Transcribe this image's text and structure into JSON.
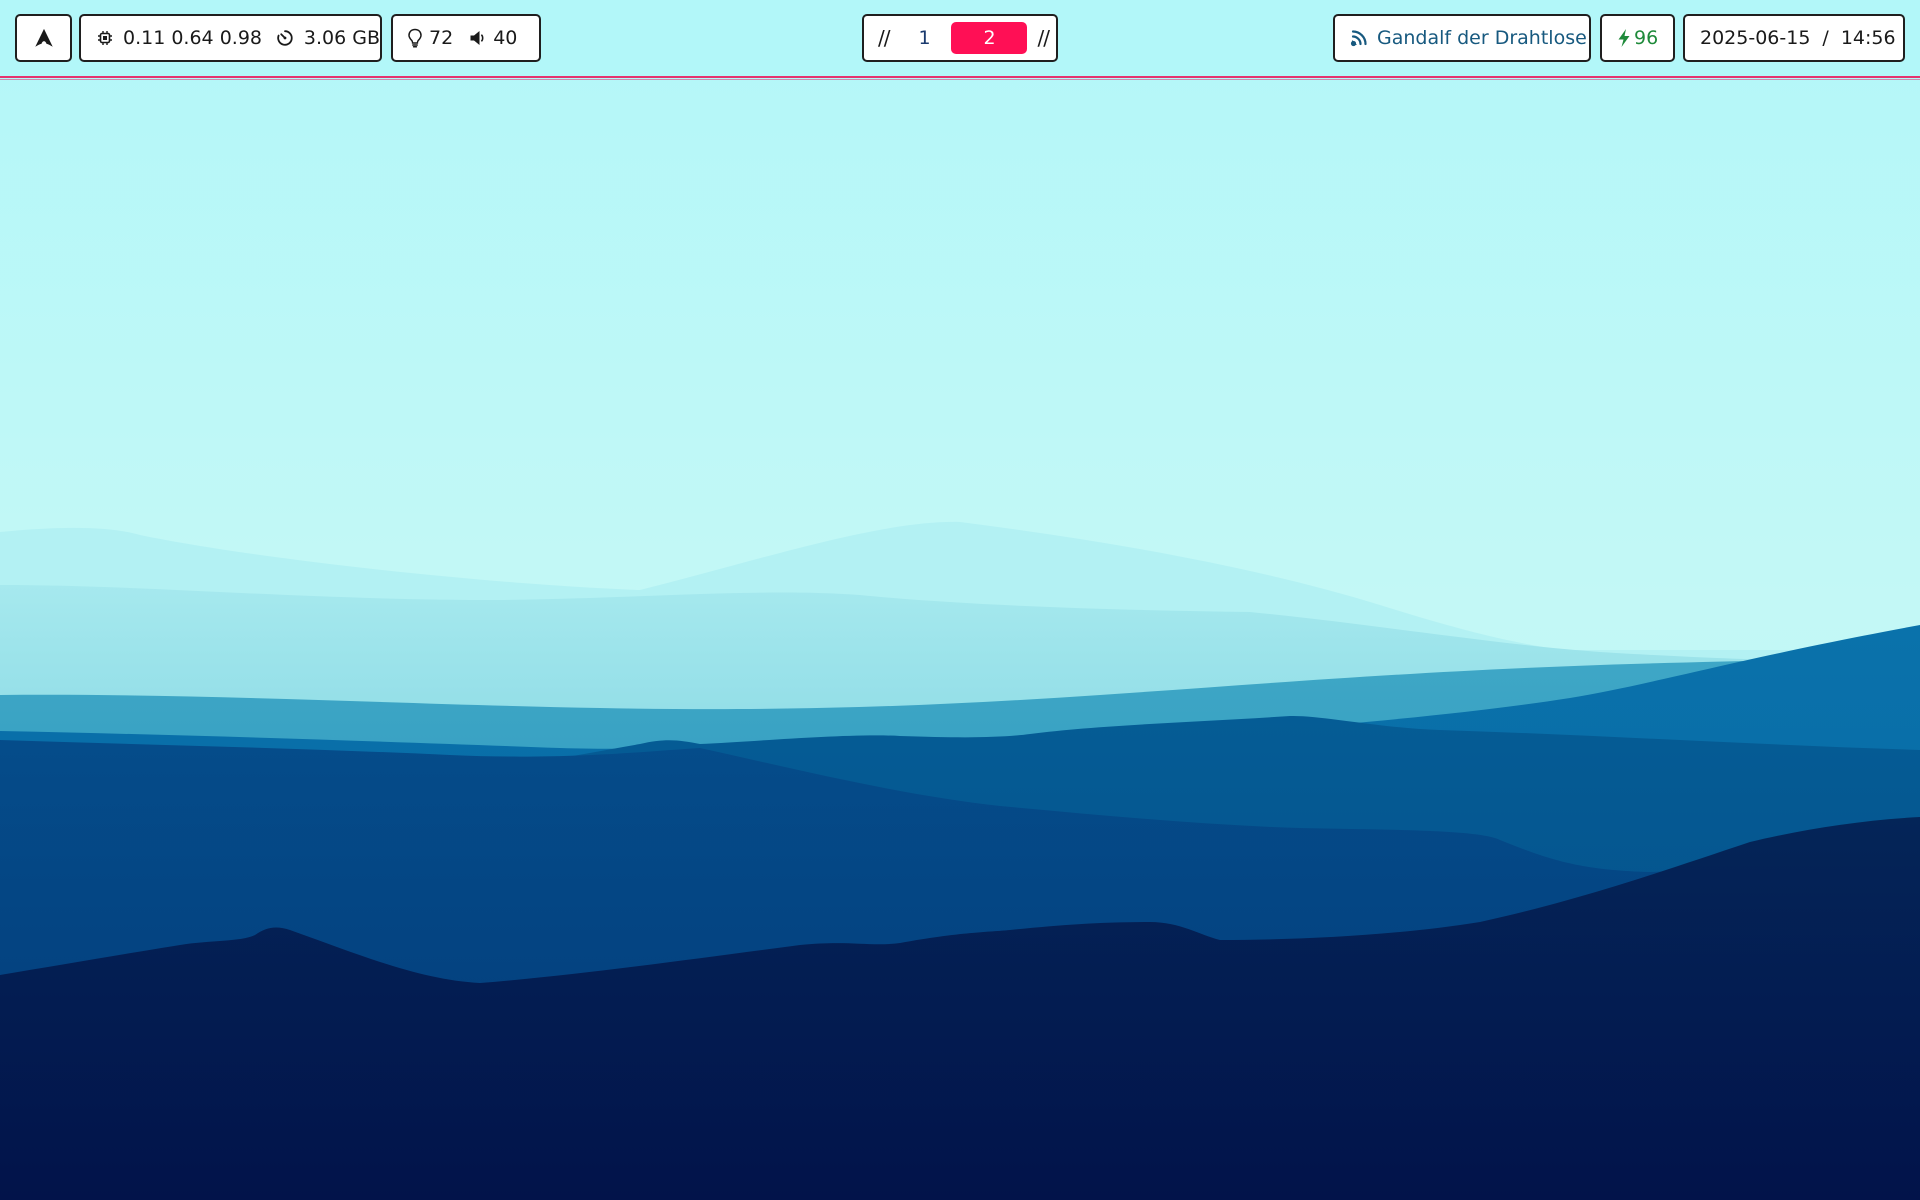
{
  "bar": {
    "accent_color": "#ff0f55",
    "background_color": "#b2f7f9",
    "border_color": "#e5326e"
  },
  "launcher": {
    "icon": "arch-logo-icon"
  },
  "system": {
    "cpu_icon": "cpu-chip-icon",
    "load": "0.11 0.64 0.98",
    "memory_icon": "memory-gauge-icon",
    "memory": "3.06 GB"
  },
  "media": {
    "brightness_icon": "lightbulb-icon",
    "brightness": "72",
    "volume_icon": "speaker-icon",
    "volume": "40"
  },
  "workspaces": {
    "separator_left": "//",
    "separator_right": "//",
    "items": [
      {
        "label": "1",
        "active": false
      },
      {
        "label": "2",
        "active": true
      }
    ]
  },
  "network": {
    "icon": "wifi-satellite-icon",
    "ssid": "Gandalf der Drahtlose",
    "color": "#17597f"
  },
  "battery": {
    "icon": "lightning-bolt-icon",
    "level": "96",
    "color": "#1e8a3a"
  },
  "clock": {
    "date": "2025-06-15",
    "separator": "/",
    "time": "14:56"
  }
}
